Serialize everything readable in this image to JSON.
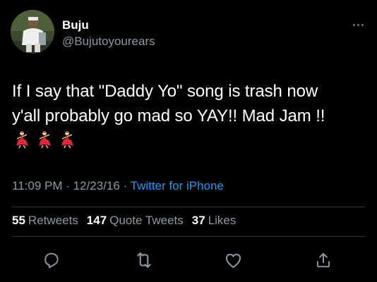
{
  "author": {
    "display_name": "Buju",
    "handle": "@Bujutoyourears"
  },
  "tweet": {
    "text": "If I say that \"Daddy Yo\" song is trash now\ny'all probably go mad so YAY!! Mad Jam !!",
    "emojis": [
      "dancer-emoji",
      "dancer-emoji",
      "dancer-emoji"
    ]
  },
  "meta": {
    "time": "11:09 PM",
    "date": "12/23/16",
    "separator": "·",
    "source": "Twitter for iPhone"
  },
  "stats": {
    "retweets_count": "55",
    "retweets_label": "Retweets",
    "quotes_count": "147",
    "quotes_label": "Quote Tweets",
    "likes_count": "37",
    "likes_label": "Likes"
  },
  "icons": {
    "more": "more-horizontal-icon",
    "reply": "reply-icon",
    "retweet": "retweet-icon",
    "like": "like-icon",
    "share": "share-icon"
  },
  "colors": {
    "background": "#000000",
    "text": "#ffffff",
    "secondary": "#8b98a5",
    "link": "#1d9bf0",
    "divider": "#2f3336"
  }
}
